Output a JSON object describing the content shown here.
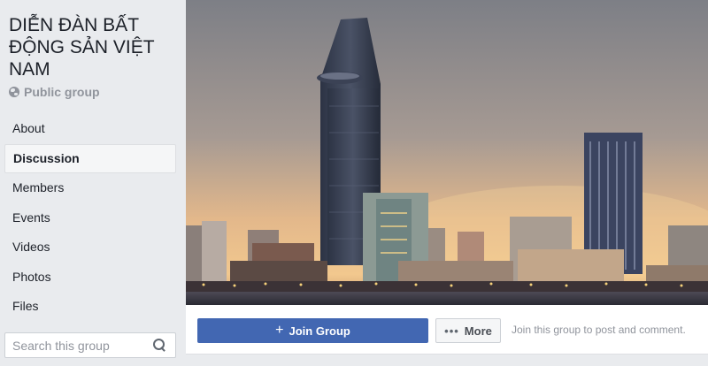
{
  "group": {
    "title": "DIỄN ĐÀN BẤT ĐỘNG SẢN VIỆT NAM",
    "privacy": "Public group"
  },
  "sidebar": {
    "items": [
      {
        "label": "About"
      },
      {
        "label": "Discussion",
        "active": true
      },
      {
        "label": "Members"
      },
      {
        "label": "Events"
      },
      {
        "label": "Videos"
      },
      {
        "label": "Photos"
      },
      {
        "label": "Files"
      }
    ],
    "search_placeholder": "Search this group"
  },
  "actions": {
    "join_label": "Join Group",
    "more_label": "More",
    "hint": "Join this group to post and comment."
  },
  "colors": {
    "primary": "#4267b2",
    "sidebar_bg": "#e9ebee",
    "text": "#1d2129",
    "muted": "#90949c"
  },
  "icons": {
    "privacy": "globe-icon",
    "search": "search-icon",
    "join": "plus-icon",
    "more": "ellipsis-icon"
  }
}
